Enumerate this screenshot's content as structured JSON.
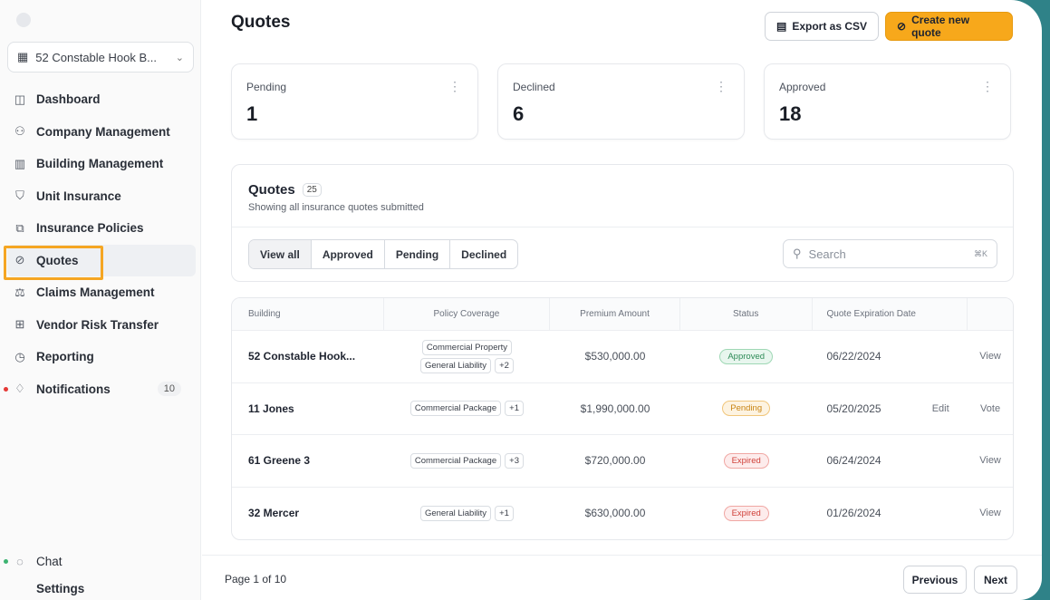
{
  "sidebar": {
    "building_select": "52 Constable Hook B...",
    "items": [
      {
        "label": "Dashboard",
        "icon": "dashboard-icon"
      },
      {
        "label": "Company Management",
        "icon": "users-icon"
      },
      {
        "label": "Building Management",
        "icon": "building-icon"
      },
      {
        "label": "Unit Insurance",
        "icon": "shield-icon"
      },
      {
        "label": "Insurance Policies",
        "icon": "policies-icon"
      },
      {
        "label": "Quotes",
        "icon": "quote-icon"
      },
      {
        "label": "Claims Management",
        "icon": "claims-icon"
      },
      {
        "label": "Vendor Risk Transfer",
        "icon": "vendor-icon"
      },
      {
        "label": "Reporting",
        "icon": "reporting-icon"
      },
      {
        "label": "Notifications",
        "icon": "bell-icon",
        "count": "10"
      }
    ],
    "bottom": {
      "chat": "Chat",
      "settings": "Settings"
    }
  },
  "header": {
    "title": "Quotes",
    "export_label": "Export as CSV",
    "create_label": "Create new quote"
  },
  "stats": [
    {
      "label": "Pending",
      "value": "1"
    },
    {
      "label": "Declined",
      "value": "6"
    },
    {
      "label": "Approved",
      "value": "18"
    }
  ],
  "panel": {
    "title": "Quotes",
    "count": "25",
    "subtitle": "Showing all insurance quotes submitted",
    "tabs": [
      "View all",
      "Approved",
      "Pending",
      "Declined"
    ],
    "search_placeholder": "Search",
    "search_shortcut": "⌘K"
  },
  "table": {
    "headers": [
      "Building",
      "Policy Coverage",
      "Premium Amount",
      "Status",
      "Quote Expiration Date"
    ],
    "rows": [
      {
        "building": "52 Constable Hook...",
        "coverage": [
          "Commercial Property",
          "General Liability"
        ],
        "extra": "+2",
        "premium": "$530,000.00",
        "status": "Approved",
        "date": "06/22/2024",
        "edit": "",
        "view": "View"
      },
      {
        "building": "11 Jones",
        "coverage": [
          "Commercial Package"
        ],
        "extra": "+1",
        "premium": "$1,990,000.00",
        "status": "Pending",
        "date": "05/20/2025",
        "edit": "Edit",
        "view": "Vote"
      },
      {
        "building": "61 Greene 3",
        "coverage": [
          "Commercial Package"
        ],
        "extra": "+3",
        "premium": "$720,000.00",
        "status": "Expired",
        "date": "06/24/2024",
        "edit": "",
        "view": "View"
      },
      {
        "building": "32 Mercer",
        "coverage": [
          "General Liability"
        ],
        "extra": "+1",
        "premium": "$630,000.00",
        "status": "Expired",
        "date": "01/26/2024",
        "edit": "",
        "view": "View"
      }
    ]
  },
  "pagination": {
    "info": "Page 1 of 10",
    "prev": "Previous",
    "next": "Next"
  },
  "colors": {
    "accent": "#f7a81b",
    "frame": "#2f8288",
    "approved": "#2e8b57",
    "pending": "#c98514",
    "expired": "#d0413a"
  }
}
